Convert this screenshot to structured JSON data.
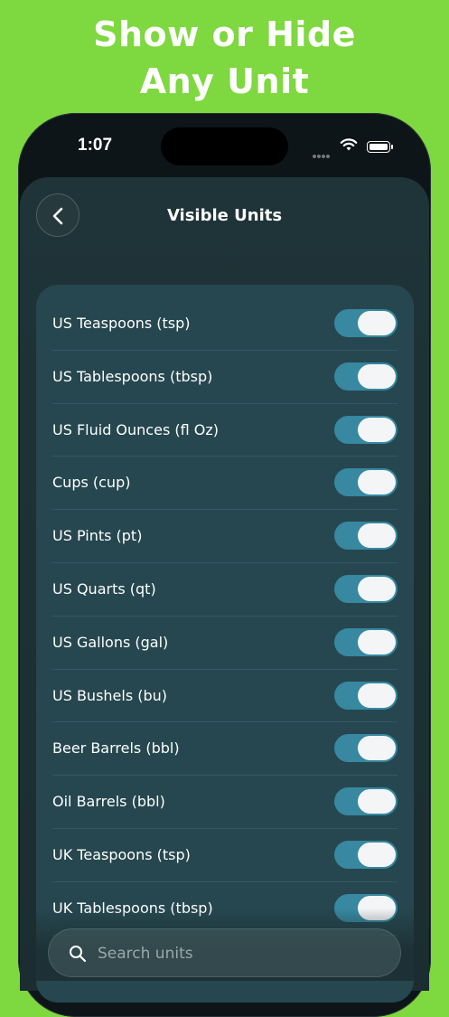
{
  "promo": {
    "line1": "Show or Hide",
    "line2": "Any Unit"
  },
  "status_bar": {
    "time": "1:07"
  },
  "nav": {
    "title": "Visible Units",
    "back_icon": "chevron-left-icon"
  },
  "units": [
    {
      "label": "US Teaspoons (tsp)",
      "visible": true
    },
    {
      "label": "US Tablespoons (tbsp)",
      "visible": true
    },
    {
      "label": "US Fluid Ounces (fl Oz)",
      "visible": true
    },
    {
      "label": "Cups (cup)",
      "visible": true
    },
    {
      "label": "US Pints (pt)",
      "visible": true
    },
    {
      "label": "US Quarts (qt)",
      "visible": true
    },
    {
      "label": "US Gallons (gal)",
      "visible": true
    },
    {
      "label": "US Bushels (bu)",
      "visible": true
    },
    {
      "label": "Beer Barrels (bbl)",
      "visible": true
    },
    {
      "label": "Oil Barrels (bbl)",
      "visible": true
    },
    {
      "label": "UK Teaspoons (tsp)",
      "visible": true
    },
    {
      "label": "UK Tablespoons (tbsp)",
      "visible": true
    }
  ],
  "search": {
    "placeholder": "Search units"
  },
  "colors": {
    "background": "#7ed83f",
    "toggle_on": "#3788a0",
    "list_bg": "#26474f"
  }
}
